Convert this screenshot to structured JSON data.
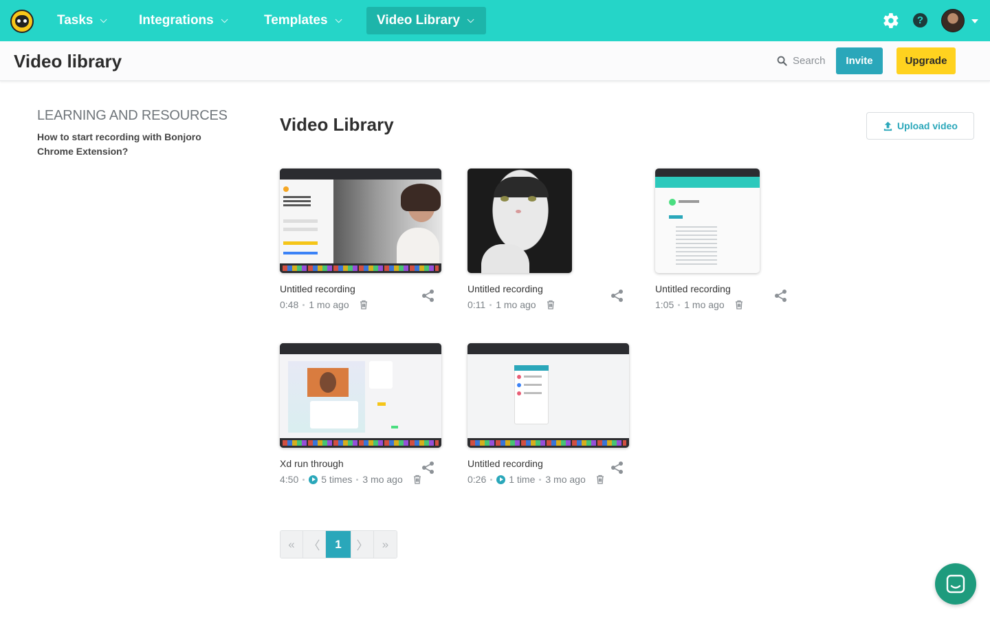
{
  "nav": {
    "items": [
      {
        "label": "Tasks"
      },
      {
        "label": "Integrations"
      },
      {
        "label": "Templates"
      },
      {
        "label": "Video Library"
      }
    ],
    "help_glyph": "?",
    "accent_color": "#25d5c8"
  },
  "header": {
    "title": "Video library",
    "search_label": "Search",
    "invite_label": "Invite",
    "upgrade_label": "Upgrade"
  },
  "resources": {
    "heading": "LEARNING AND RESOURCES",
    "link": "How to start recording with Bonjoro Chrome Extension?"
  },
  "library": {
    "title": "Video Library",
    "upload_label": "Upload video",
    "videos": [
      {
        "title": "Untitled recording",
        "duration": "0:48",
        "views": "",
        "age": "1 mo ago"
      },
      {
        "title": "Untitled recording",
        "duration": "0:11",
        "views": "",
        "age": "1 mo ago"
      },
      {
        "title": "Untitled recording",
        "duration": "1:05",
        "views": "",
        "age": "1 mo ago"
      },
      {
        "title": "Xd run through",
        "duration": "4:50",
        "views": "5 times",
        "age": "3 mo ago"
      },
      {
        "title": "Untitled recording",
        "duration": "0:26",
        "views": "1 time",
        "age": "3 mo ago"
      }
    ]
  },
  "pagination": {
    "first": "«",
    "prev": "〈",
    "current": "1",
    "next": "〉",
    "last": "»"
  },
  "icons": {
    "logo": "bonjoro-logo-icon",
    "settings": "gear-icon",
    "help": "help-icon",
    "search": "search-icon",
    "upload": "upload-icon",
    "share": "share-icon",
    "delete": "trash-icon",
    "views": "play-icon",
    "chat": "chat-icon"
  }
}
